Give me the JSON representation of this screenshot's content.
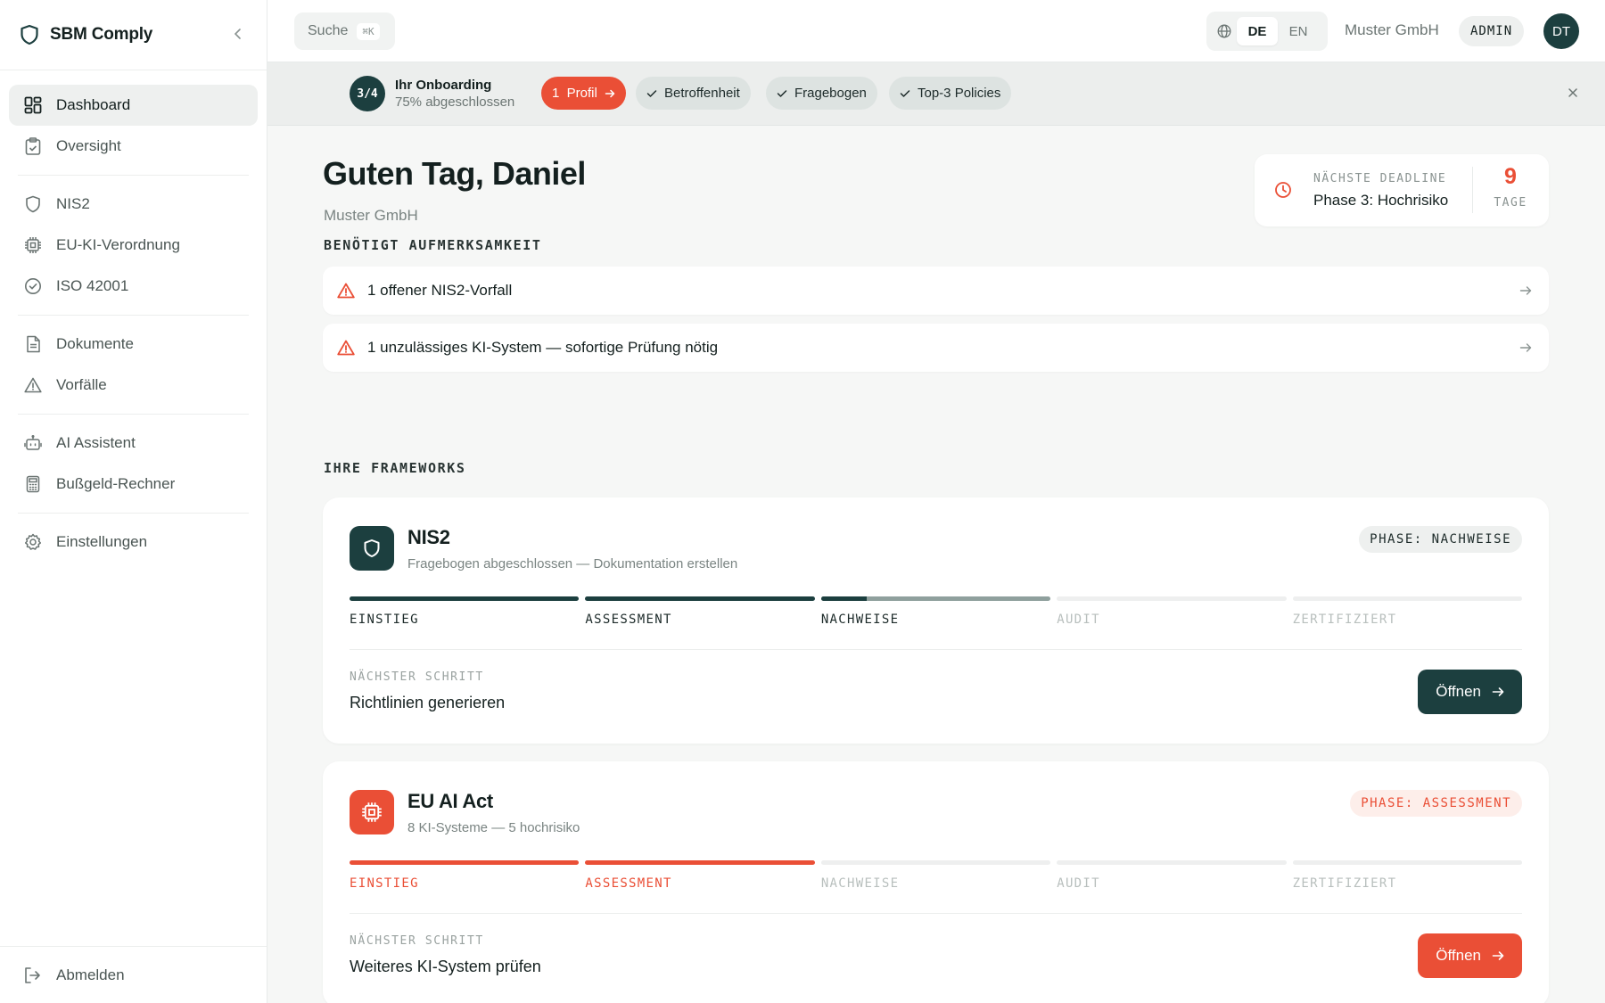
{
  "sidebar": {
    "brand": "SBM Comply",
    "items": [
      {
        "label": "Dashboard"
      },
      {
        "label": "Oversight"
      },
      {
        "label": "NIS2"
      },
      {
        "label": "EU-KI-Verordnung"
      },
      {
        "label": "ISO 42001"
      },
      {
        "label": "Dokumente"
      },
      {
        "label": "Vorfälle"
      },
      {
        "label": "AI Assistent"
      },
      {
        "label": "Bußgeld-Rechner"
      },
      {
        "label": "Einstellungen"
      }
    ],
    "logout": "Abmelden"
  },
  "topbar": {
    "search_label": "Suche",
    "search_shortcut": "⌘K",
    "lang_de": "DE",
    "lang_en": "EN",
    "org": "Muster GmbH",
    "role": "ADMIN",
    "avatar": "DT"
  },
  "onboarding": {
    "progress": "3/4",
    "title": "Ihr Onboarding",
    "subtitle": "75% abgeschlossen",
    "steps": [
      {
        "label": "1  Profil"
      },
      {
        "label": "Betroffenheit"
      },
      {
        "label": "Fragebogen"
      },
      {
        "label": "Top-3 Policies"
      }
    ]
  },
  "main": {
    "greeting": "Guten Tag, Daniel",
    "org": "Muster GmbH",
    "deadline": {
      "label": "NÄCHSTE DEADLINE",
      "value": "Phase 3: Hochrisiko",
      "days": "9",
      "unit": "TAGE"
    },
    "attention_heading": "BENÖTIGT AUFMERKSAMKEIT",
    "alerts": [
      {
        "text": "1 offener NIS2-Vorfall"
      },
      {
        "text": "1 unzulässiges KI-System — sofortige Prüfung nötig"
      }
    ],
    "frameworks_heading": "IHRE FRAMEWORKS",
    "frameworks": [
      {
        "name": "NIS2",
        "desc": "Fragebogen abgeschlossen — Dokumentation erstellen",
        "phase": "PHASE: NACHWEISE",
        "stages": [
          "EINSTIEG",
          "ASSESSMENT",
          "NACHWEISE",
          "AUDIT",
          "ZERTIFIZIERT"
        ],
        "next_label": "NÄCHSTER SCHRITT",
        "next_value": "Richtlinien generieren",
        "button": "Öffnen",
        "accent": "#1c3f3f"
      },
      {
        "name": "EU AI Act",
        "desc": "8 KI-Systeme — 5 hochrisiko",
        "phase": "PHASE: ASSESSMENT",
        "stages": [
          "EINSTIEG",
          "ASSESSMENT",
          "NACHWEISE",
          "AUDIT",
          "ZERTIFIZIERT"
        ],
        "next_label": "NÄCHSTER SCHRITT",
        "next_value": "Weiteres KI-System prüfen",
        "button": "Öffnen",
        "accent": "#ea4f36"
      }
    ]
  }
}
